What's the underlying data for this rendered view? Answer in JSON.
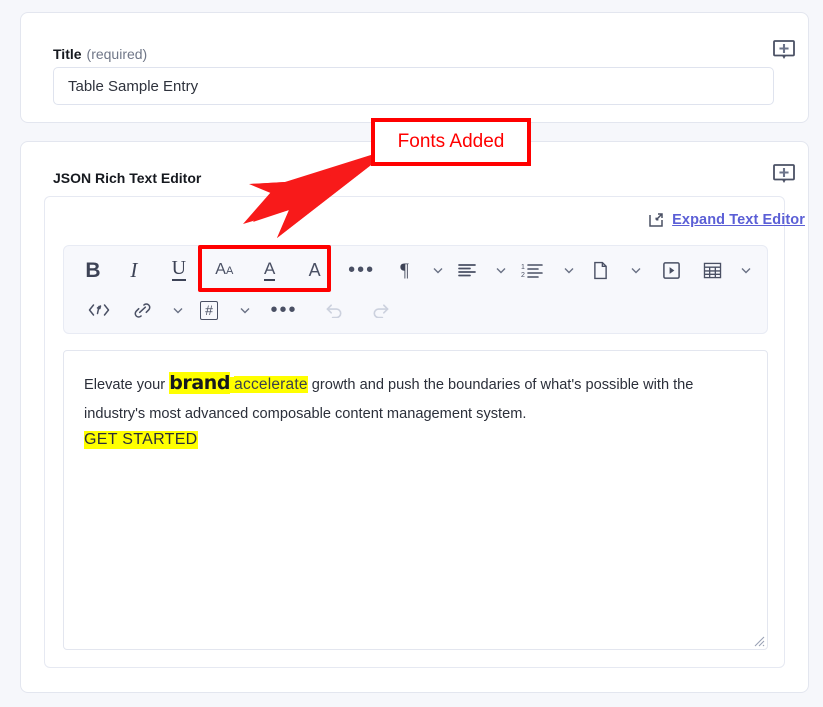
{
  "colors": {
    "page_bg": "#f6f7fb",
    "card_bg": "#ffffff",
    "accent_link": "#5b5fd6",
    "annotation_red": "#ff0000",
    "highlight_yellow": "#ffff00",
    "toolbar_bg": "#f7f8fc"
  },
  "title_field": {
    "label": "Title",
    "required_note": "(required)",
    "value": "Table Sample Entry",
    "placeholder": "Title",
    "comment_icon": "add-comment-icon"
  },
  "editor_field": {
    "label": "JSON Rich Text Editor",
    "comment_icon": "add-comment-icon",
    "expand": {
      "icon": "expand-arrow-icon",
      "label": "Expand Text Editor"
    }
  },
  "toolbar": {
    "row1": [
      {
        "name": "bold-button",
        "glyph": "B",
        "caret": false,
        "disabled": false
      },
      {
        "name": "italic-button",
        "glyph": "I",
        "caret": false,
        "disabled": false
      },
      {
        "name": "underline-button",
        "glyph": "U",
        "caret": false,
        "disabled": false
      },
      {
        "name": "font-family-button",
        "glyph": "Aa",
        "caret": false,
        "disabled": false
      },
      {
        "name": "text-color-button",
        "glyph": "A",
        "caret": false,
        "disabled": false
      },
      {
        "name": "background-color-button",
        "glyph": "A",
        "caret": false,
        "disabled": false
      },
      {
        "name": "more-formatting-button",
        "glyph": "•••",
        "caret": false,
        "disabled": false
      },
      {
        "name": "paragraph-style-button",
        "glyph": "¶",
        "caret": true,
        "disabled": false
      },
      {
        "name": "text-align-button",
        "glyph": "align",
        "caret": true,
        "disabled": false
      },
      {
        "name": "numbered-list-button",
        "glyph": "list",
        "caret": true,
        "disabled": false
      },
      {
        "name": "insert-file-button",
        "glyph": "file",
        "caret": true,
        "disabled": false
      },
      {
        "name": "insert-video-button",
        "glyph": "video",
        "caret": false,
        "disabled": false
      },
      {
        "name": "insert-table-button",
        "glyph": "table",
        "caret": true,
        "disabled": false
      }
    ],
    "row2": [
      {
        "name": "code-block-button",
        "glyph": "</>",
        "caret": false,
        "disabled": false
      },
      {
        "name": "insert-link-button",
        "glyph": "link",
        "caret": true,
        "disabled": false
      },
      {
        "name": "anchor-button",
        "glyph": "#",
        "caret": true,
        "disabled": false
      },
      {
        "name": "more-tools-button",
        "glyph": "•••",
        "caret": false,
        "disabled": false
      },
      {
        "name": "undo-button",
        "glyph": "undo",
        "caret": false,
        "disabled": true
      },
      {
        "name": "redo-button",
        "glyph": "redo",
        "caret": false,
        "disabled": true
      }
    ]
  },
  "content": {
    "line1_pre": "Elevate your ",
    "word_brand": "brand",
    "word_space": " ",
    "word_accelerate": "accelerate",
    "line1_post": " growth and push the boundaries of what's possible with the industry's most advanced composable content management system.",
    "cta": "GET STARTED"
  },
  "annotation": {
    "label": "Fonts Added",
    "arrow": "red-arrow"
  }
}
